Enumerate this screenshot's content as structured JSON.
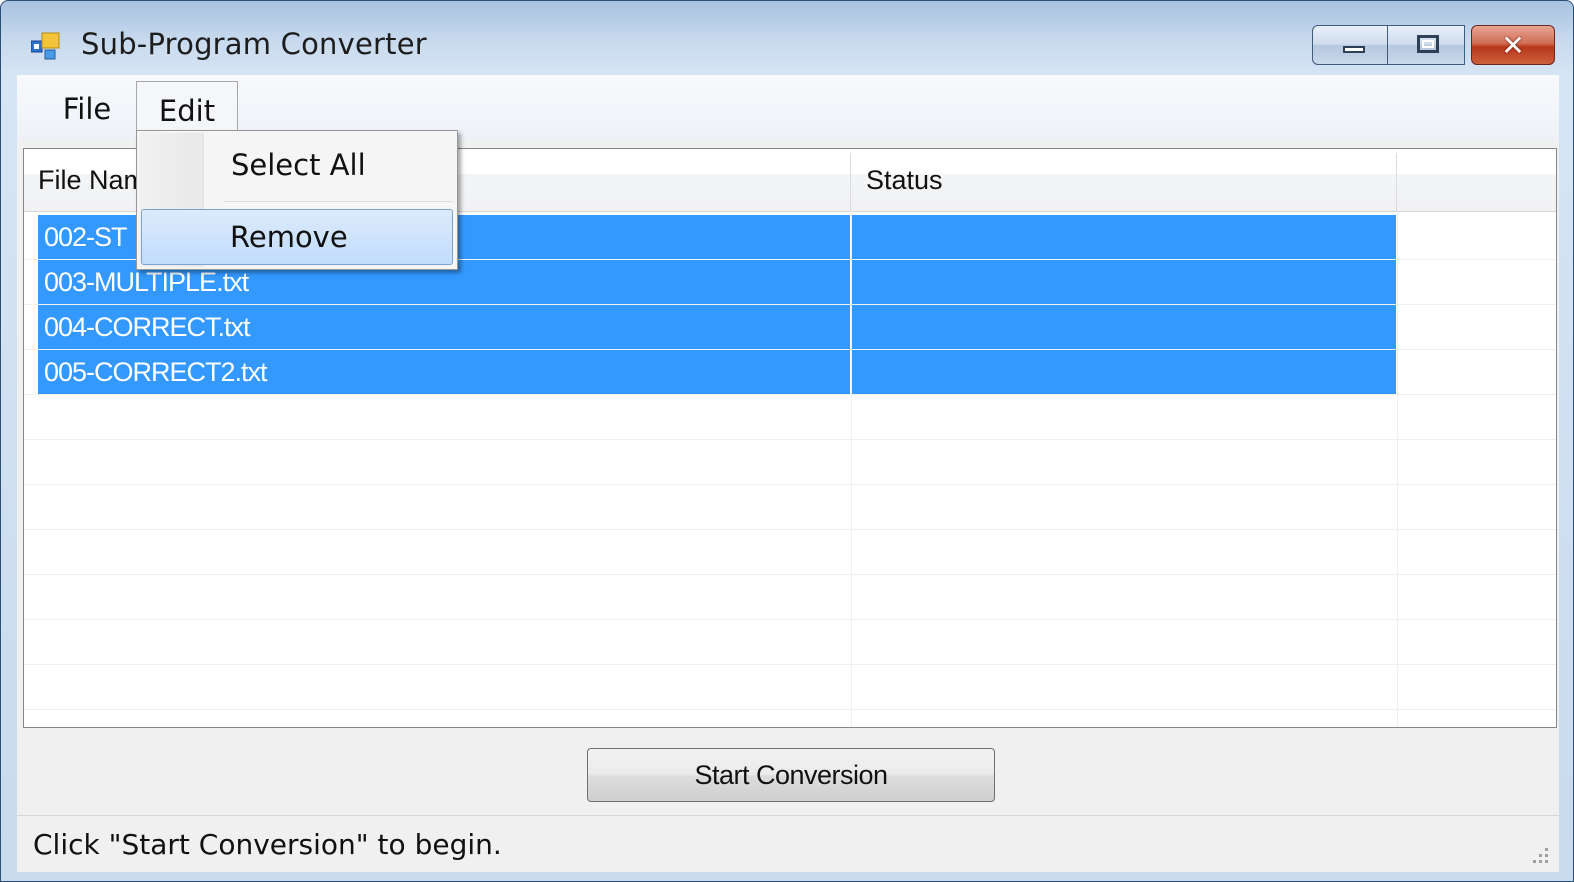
{
  "window": {
    "title": "Sub-Program Converter",
    "icon": "app-window-icon",
    "caption_buttons": [
      "minimize-icon",
      "maximize-icon",
      "close-icon"
    ]
  },
  "menubar": {
    "items": [
      {
        "label": "File"
      },
      {
        "label": "Edit"
      }
    ]
  },
  "edit_menu": {
    "items": [
      {
        "label": "Select All"
      },
      {
        "label": "Remove"
      }
    ],
    "highlighted": "Remove"
  },
  "listview": {
    "columns": [
      "File Name",
      "Status"
    ],
    "rows": [
      {
        "file": "002-ST",
        "status": "",
        "selected": true
      },
      {
        "file": "003-MULTIPLE.txt",
        "status": "",
        "selected": true
      },
      {
        "file": "004-CORRECT.txt",
        "status": "",
        "selected": true
      },
      {
        "file": "005-CORRECT2.txt",
        "status": "",
        "selected": true
      }
    ],
    "selection_color": "#3399ff"
  },
  "actions": {
    "start_label": "Start Conversion"
  },
  "statusbar": {
    "text": "Click \"Start Conversion\" to begin."
  }
}
